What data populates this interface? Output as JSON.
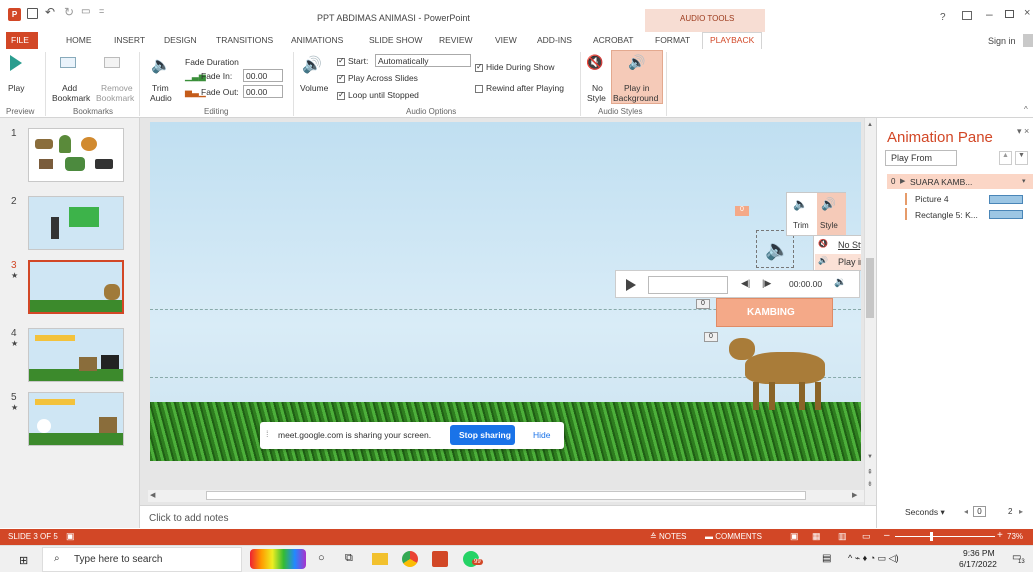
{
  "window": {
    "title": "PPT ABDIMAS ANIMASI - PowerPoint",
    "context_tab": "AUDIO TOOLS",
    "help": "?",
    "sign_in": "Sign in"
  },
  "tabs": [
    "FILE",
    "HOME",
    "INSERT",
    "DESIGN",
    "TRANSITIONS",
    "ANIMATIONS",
    "SLIDE SHOW",
    "REVIEW",
    "VIEW",
    "ADD-INS",
    "ACROBAT",
    "FORMAT",
    "PLAYBACK"
  ],
  "ribbon": {
    "preview": {
      "play": "Play",
      "group": "Preview"
    },
    "bookmarks": {
      "add": "Add\nBookmark",
      "add_l1": "Add",
      "add_l2": "Bookmark",
      "remove_l1": "Remove",
      "remove_l2": "Bookmark",
      "group": "Bookmarks"
    },
    "editing": {
      "trim_l1": "Trim",
      "trim_l2": "Audio",
      "fade_duration": "Fade Duration",
      "fade_in_label": "Fade In:",
      "fade_in_value": "00.00",
      "fade_out_label": "Fade Out:",
      "fade_out_value": "00.00",
      "group": "Editing"
    },
    "audio_options": {
      "volume": "Volume",
      "start_label": "Start:",
      "start_value": "Automatically",
      "play_across": "Play Across Slides",
      "loop": "Loop until Stopped",
      "hide": "Hide During Show",
      "rewind": "Rewind after Playing",
      "group": "Audio Options"
    },
    "audio_styles": {
      "no_style_l1": "No",
      "no_style_l2": "Style",
      "bg_l1": "Play in",
      "bg_l2": "Background",
      "group": "Audio Styles"
    }
  },
  "slides": [
    {
      "num": "1",
      "star": ""
    },
    {
      "num": "2",
      "star": ""
    },
    {
      "num": "3",
      "star": "★"
    },
    {
      "num": "4",
      "star": "★"
    },
    {
      "num": "5",
      "star": "★"
    }
  ],
  "slide": {
    "caption": "KAMBING",
    "tag_0a": "0",
    "tag_0b": "0",
    "tag_0c": "0",
    "player_time": "00:00.00",
    "trim": "Trim",
    "style": "Style",
    "menu": [
      "No Style",
      "Play in Background"
    ],
    "share_text": "meet.google.com is sharing your screen.",
    "stop_sharing": "Stop sharing",
    "hide": "Hide"
  },
  "notes": "Click to add notes",
  "animation_pane": {
    "title": "Animation Pane",
    "play_from": "Play From",
    "items": [
      {
        "num": "0",
        "label": "SUARA KAMB..."
      },
      {
        "num": "",
        "label": "Picture 4"
      },
      {
        "num": "",
        "label": "Rectangle 5: K..."
      }
    ],
    "seconds": "Seconds",
    "page_a": "0",
    "page_b": "2"
  },
  "status": {
    "slide": "SLIDE 3 OF 5",
    "notes": "NOTES",
    "comments": "COMMENTS",
    "zoom": "73%"
  },
  "taskbar": {
    "search": "Type here to search",
    "time": "9:36 PM",
    "date": "6/17/2022",
    "badge": "99",
    "notif": "13"
  },
  "colors": {
    "accent": "#d24726",
    "context": "#f4c7b5"
  }
}
